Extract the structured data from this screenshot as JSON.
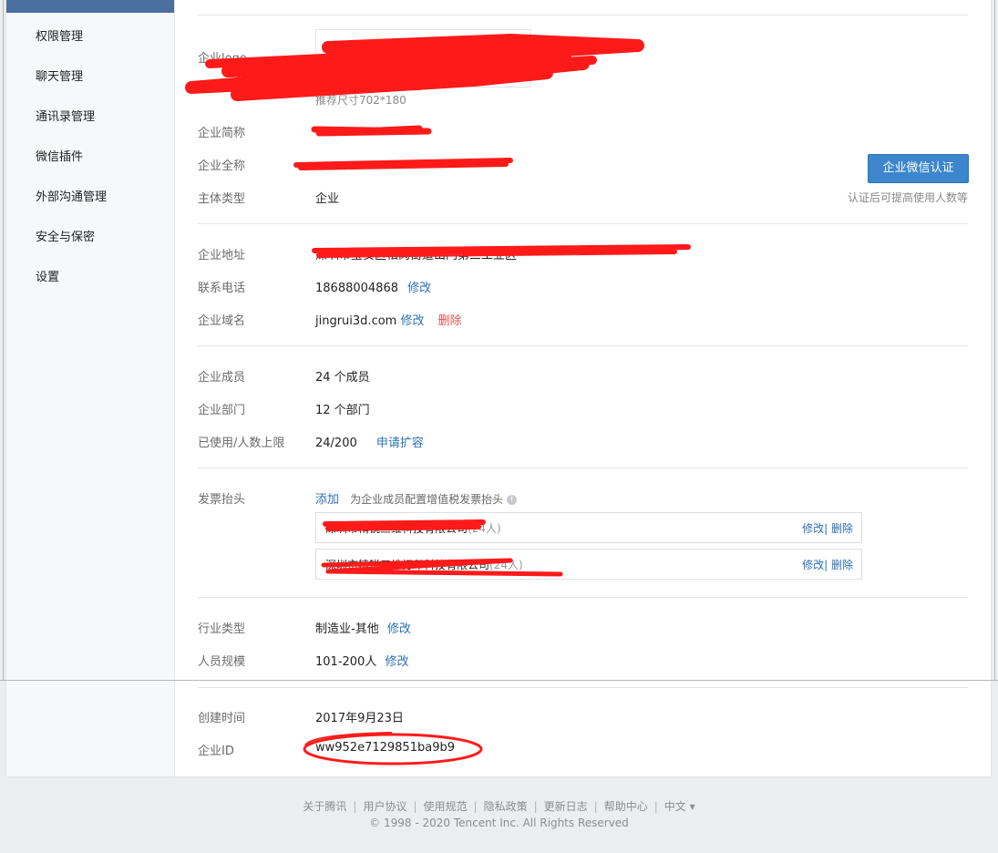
{
  "sidebar": {
    "items": [
      {
        "label": "权限管理"
      },
      {
        "label": "聊天管理"
      },
      {
        "label": "通讯录管理"
      },
      {
        "label": "微信插件"
      },
      {
        "label": "外部沟通管理"
      },
      {
        "label": "安全与保密"
      },
      {
        "label": "设置"
      }
    ]
  },
  "profile": {
    "logo_label": "企业logo",
    "logo_hint": "推荐尺寸702*180",
    "short_name_label": "企业简称",
    "full_name_label": "企业全称",
    "entity_type_label": "主体类型",
    "entity_type_value": "企业",
    "verify_button": "企业微信认证",
    "verify_hint": "认证后可提高使用人数等"
  },
  "contact": {
    "address_label": "企业地址",
    "address_value": "深圳市宝安区松岗街道山门第三工业区",
    "phone_label": "联系电话",
    "phone_value": "18688004868",
    "phone_edit": "修改",
    "domain_label": "企业域名",
    "domain_value": "jingrui3d.com",
    "domain_edit": "修改",
    "domain_delete": "删除"
  },
  "members": {
    "members_label": "企业成员",
    "members_value": "24 个成员",
    "departments_label": "企业部门",
    "departments_value": "12 个部门",
    "limit_label": "已使用/人数上限",
    "limit_value": "24/200",
    "limit_expand": "申请扩容"
  },
  "invoice": {
    "label": "发票抬头",
    "add_link": "添加",
    "add_hint": "为企业成员配置增值税发票抬头",
    "rows": [
      {
        "name": "深圳市精锐三维科技有限公司",
        "count": "(24人)",
        "edit": "修改",
        "sep": "|",
        "delete": "删除"
      },
      {
        "name": "深圳市精锐三维打印科技有限公司",
        "count": "(24人)",
        "edit": "修改",
        "sep": "|",
        "delete": "删除"
      }
    ]
  },
  "industry": {
    "industry_label": "行业类型",
    "industry_value": "制造业-其他",
    "industry_edit": "修改",
    "scale_label": "人员规模",
    "scale_value": "101-200人",
    "scale_edit": "修改"
  },
  "meta": {
    "created_label": "创建时间",
    "created_value": "2017年9月23日",
    "id_label": "企业ID",
    "id_value": "ww952e7129851ba9b9"
  },
  "footer": {
    "links": [
      "关于腾讯",
      "用户协议",
      "使用规范",
      "隐私政策",
      "更新日志",
      "帮助中心",
      "中文 ▾"
    ],
    "copyright": "© 1998 - 2020 Tencent Inc. All Rights Reserved"
  },
  "colors": {
    "accent": "#3b86cc",
    "link": "#2b6fb6",
    "delete": "#e05050",
    "redaction": "#ff0000"
  }
}
